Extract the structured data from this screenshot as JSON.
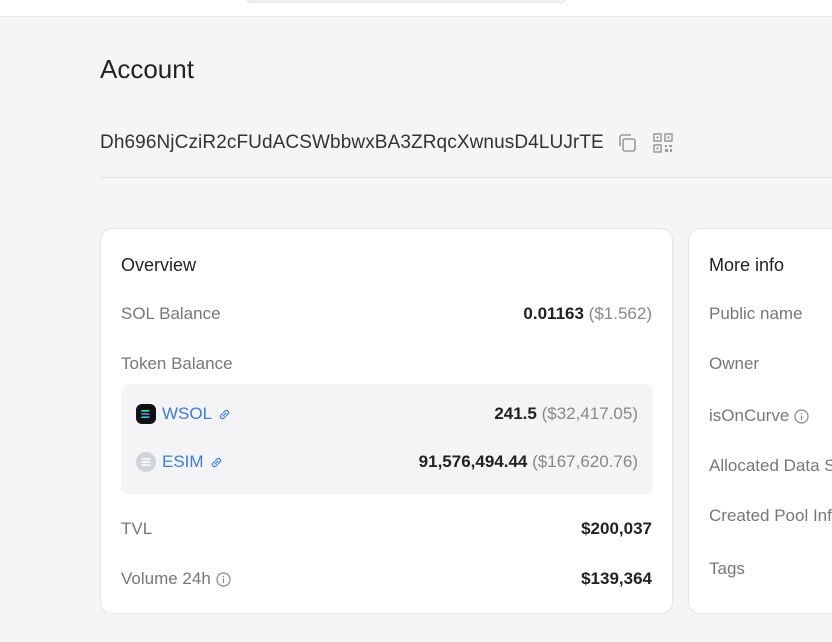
{
  "header": {
    "title": "Account"
  },
  "account": {
    "address": "Dh696NjCziR2cFUdACSWbbwxBA3ZRqcXwnusD4LUJrTE",
    "copy_icon": "copy-icon",
    "qr_icon": "qr-code-icon"
  },
  "overview": {
    "title": "Overview",
    "sol_balance_label": "SOL Balance",
    "sol_balance_value": "0.01163",
    "sol_balance_usd": "($1.562)",
    "token_balance_label": "Token Balance",
    "tokens": [
      {
        "symbol": "WSOL",
        "amount": "241.5",
        "usd": "($32,417.05)",
        "logo": "solana-logo-icon",
        "link_icon": "link-icon"
      },
      {
        "symbol": "ESIM",
        "amount": "91,576,494.44",
        "usd": "($167,620.76)",
        "logo": "token-logo-icon",
        "link_icon": "link-icon"
      }
    ],
    "tvl_label": "TVL",
    "tvl_value": "$200,037",
    "volume_label": "Volume 24h",
    "volume_value": "$139,364"
  },
  "more_info": {
    "title": "More info",
    "rows": [
      {
        "label": "Public name"
      },
      {
        "label": "Owner"
      },
      {
        "label": "isOnCurve",
        "icon": "info-icon"
      },
      {
        "label": "Allocated Data S"
      },
      {
        "label": "Created Pool Inf"
      },
      {
        "label": "Tags"
      }
    ]
  },
  "colors": {
    "background": "#f5f5f6",
    "card": "#ffffff",
    "link": "#3b7ddd",
    "muted": "#888888"
  }
}
